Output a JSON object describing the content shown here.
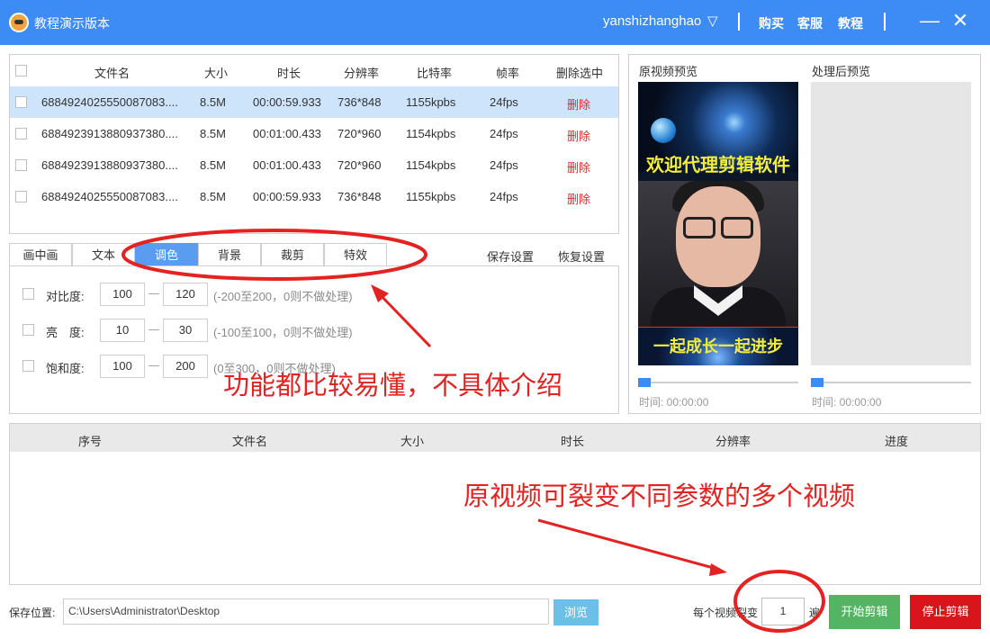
{
  "app": {
    "title": "教程演示版本",
    "user": "yanshizhanghao",
    "user_caret": "▽",
    "menu": [
      "购买",
      "客服",
      "教程"
    ],
    "minimize": "—",
    "close": "✕"
  },
  "file_table": {
    "headers": [
      "文件名",
      "大小",
      "时长",
      "分辨率",
      "比特率",
      "帧率",
      "删除选中"
    ],
    "rows": [
      {
        "name": "6884924025550087083....",
        "size": "8.5M",
        "duration": "00:00:59.933",
        "resolution": "736*848",
        "bitrate": "1155kpbs",
        "fps": "24fps",
        "action": "删除"
      },
      {
        "name": "6884923913880937380....",
        "size": "8.5M",
        "duration": "00:01:00.433",
        "resolution": "720*960",
        "bitrate": "1154kpbs",
        "fps": "24fps",
        "action": "删除"
      },
      {
        "name": "6884923913880937380....",
        "size": "8.5M",
        "duration": "00:01:00.433",
        "resolution": "720*960",
        "bitrate": "1154kpbs",
        "fps": "24fps",
        "action": "删除"
      },
      {
        "name": "6884924025550087083....",
        "size": "8.5M",
        "duration": "00:00:59.933",
        "resolution": "736*848",
        "bitrate": "1155kpbs",
        "fps": "24fps",
        "action": "删除"
      }
    ]
  },
  "tabs": [
    "画中画",
    "文本",
    "调色",
    "背景",
    "裁剪",
    "特效"
  ],
  "tab_links": [
    "保存设置",
    "恢复设置"
  ],
  "settings": [
    {
      "label": "对比度:",
      "min": "100",
      "max": "120",
      "hint": "(-200至200，0则不做处理)"
    },
    {
      "label": "亮　度:",
      "min": "10",
      "max": "30",
      "hint": "(-100至100，0则不做处理)"
    },
    {
      "label": "饱和度:",
      "min": "100",
      "max": "200",
      "hint": "(0至300，0则不做处理)"
    }
  ],
  "preview": {
    "original_label": "原视频预览",
    "processed_label": "处理后预览",
    "caption_top": "欢迎代理剪辑软件",
    "caption_bottom": "一起成长一起进步",
    "time_original": "时间:  00:00:00",
    "time_processed": "时间:  00:00:00"
  },
  "output_table": {
    "headers": [
      "序号",
      "文件名",
      "大小",
      "时长",
      "分辨率",
      "进度"
    ]
  },
  "footer": {
    "save_label": "保存位置:",
    "save_path": "C:\\Users\\Administrator\\Desktop",
    "browse": "浏览",
    "split_label": "每个视频裂变",
    "split_value": "1",
    "split_unit": "遍",
    "start": "开始剪辑",
    "stop": "停止剪辑"
  },
  "annotations": {
    "text1": "功能都比较易懂，不具体介绍",
    "text2": "原视频可裂变不同参数的多个视频",
    "color": "#e32222"
  }
}
